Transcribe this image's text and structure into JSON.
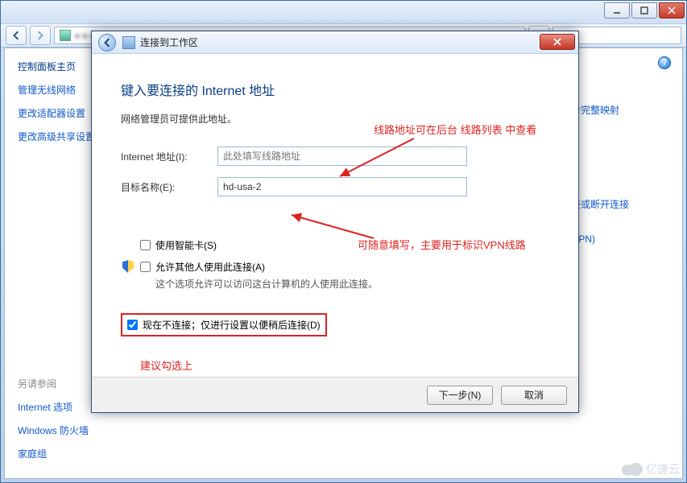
{
  "sidebar": {
    "head": "控制面板主页",
    "items": [
      "管理无线网络",
      "更改适配器设置",
      "更改高级共享设置"
    ],
    "also_label": "另请参阅",
    "also_items": [
      "Internet 选项",
      "Windows 防火墙",
      "家庭组"
    ]
  },
  "right_links": [
    "查看完整映射",
    "连接或断开连接",
    "unVPN)"
  ],
  "dialog": {
    "title": "连接到工作区",
    "heading": "键入要连接的 Internet 地址",
    "sub": "网络管理员可提供此地址。",
    "addr_label": "Internet 地址(I):",
    "addr_placeholder": "此处填写线路地址",
    "dest_label": "目标名称(E):",
    "dest_value": "hd-usa-2",
    "chk_smartcard": "使用智能卡(S)",
    "chk_allow": "允许其他人使用此连接(A)",
    "chk_allow_note": "这个选项允许可以访问这台计算机的人使用此连接。",
    "chk_defer": "现在不连接；仅进行设置以便稍后连接(D)",
    "btn_next": "下一步(N)",
    "btn_cancel": "取消"
  },
  "annotations": {
    "top": "线路地址可在后台 线路列表 中查看",
    "mid": "可随意填写，主要用于标识VPN线路",
    "bottom": "建议勾选上"
  },
  "watermark": "亿速云"
}
